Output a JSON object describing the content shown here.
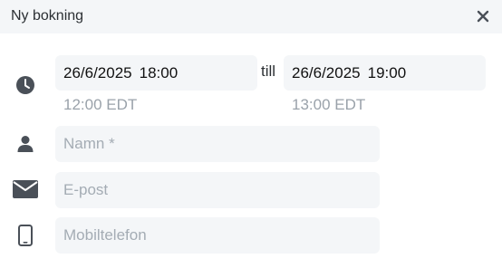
{
  "dialog": {
    "title": "Ny bokning",
    "close_icon": "close-icon"
  },
  "time": {
    "icon": "clock-icon",
    "start_date": "26/6/2025",
    "start_time": "18:00",
    "start_tz": "12:00 EDT",
    "separator": "till",
    "end_date": "26/6/2025",
    "end_time": "19:00",
    "end_tz": "13:00 EDT"
  },
  "name": {
    "icon": "person-icon",
    "placeholder": "Namn *",
    "value": ""
  },
  "email": {
    "icon": "envelope-icon",
    "placeholder": "E-post",
    "value": ""
  },
  "phone": {
    "icon": "mobile-phone-icon",
    "placeholder": "Mobiltelefon",
    "value": ""
  },
  "colors": {
    "header_bg": "#f4f6f8",
    "field_bg": "#f4f6f8",
    "icon": "#4a5058",
    "placeholder": "#a4acb4",
    "muted": "#9aa2aa"
  }
}
